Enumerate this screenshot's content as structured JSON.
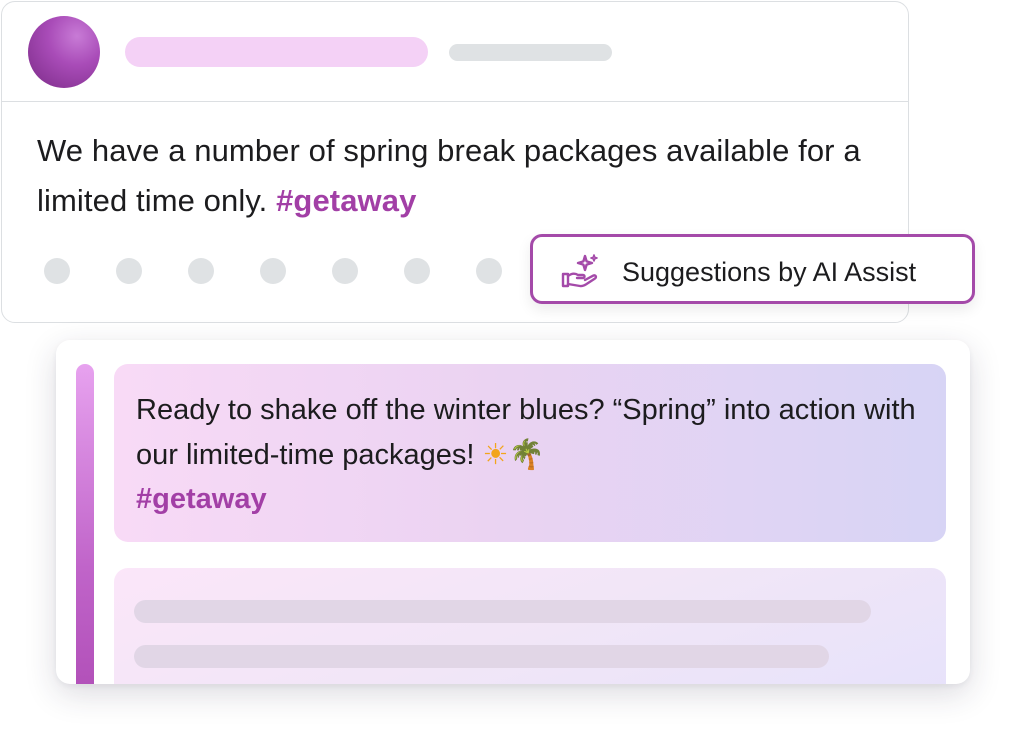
{
  "post": {
    "text": "We have a number of spring break packages available for a limited time only.",
    "hashtag": "#getaway",
    "avatar_icon": "avatar-icon",
    "action_count": 7,
    "colors": {
      "hashtag": "#a23fa6",
      "avatar": "#9b3ea8",
      "placeholder_name": "#f4d1f6",
      "placeholder_meta": "#dfe2e4"
    }
  },
  "ai_assist": {
    "label": "Suggestions by AI Assist",
    "icon": "sparkle-hand-icon",
    "accent_color": "#a44aa9"
  },
  "suggestions": {
    "items": [
      {
        "text": "Ready to shake off the winter blues? “Spring” into action with our limited-time packages!",
        "emoji_sun": "☀",
        "emoji_palm": "🌴",
        "hashtag": "#getaway"
      }
    ]
  }
}
